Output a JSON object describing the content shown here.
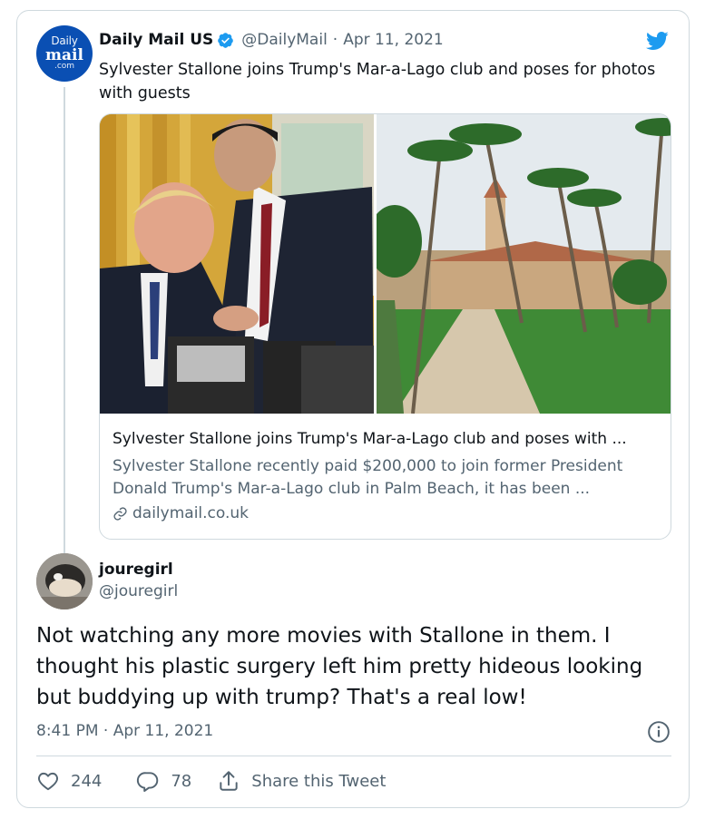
{
  "quoted_tweet": {
    "avatar_lines": [
      "Daily",
      "mail",
      ".com"
    ],
    "name": "Daily Mail US",
    "handle": "@DailyMail",
    "separator": "·",
    "date": "Apr 11, 2021",
    "text": "Sylvester Stallone joins Trump's Mar-a-Lago club and poses for photos with guests",
    "link_card": {
      "title": "Sylvester Stallone joins Trump's Mar-a-Lago club and poses with ...",
      "description": "Sylvester Stallone recently paid $200,000 to join former President Donald Trump's Mar-a-Lago club in Palm Beach, it has been ...",
      "domain": "dailymail.co.uk"
    }
  },
  "reply_tweet": {
    "name": "jouregirl",
    "handle": "@jouregirl",
    "text": "Not watching any more movies with Stallone in them.  I thought his plastic surgery left him pretty hideous looking but buddying up with trump?  That's a real low!",
    "time": "8:41 PM · Apr 11, 2021"
  },
  "actions": {
    "likes": "244",
    "replies": "78",
    "share_label": "Share this Tweet"
  },
  "icons": [
    "verified-badge-icon",
    "twitter-bird-icon",
    "link-icon",
    "info-icon",
    "heart-icon",
    "reply-icon",
    "share-icon"
  ],
  "colors": {
    "twitter_blue": "#1d9bf0",
    "daily_mail_blue": "#0a4fb3",
    "secondary_text": "#536471",
    "border": "#cfd9de"
  }
}
